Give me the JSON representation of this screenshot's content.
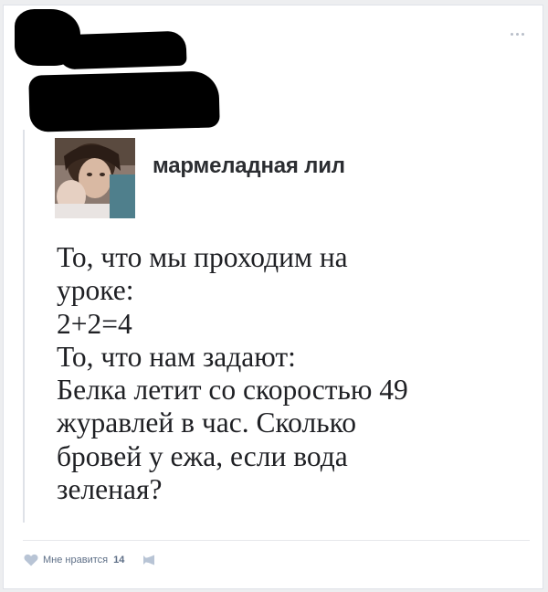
{
  "post": {
    "author_name": "мармеладная лил",
    "text_lines": [
      "То, что мы проходим на",
      "уроке:",
      "2+2=4",
      "То, что нам задают:",
      "Белка летит со скоростью 49",
      "журавлей в час. Сколько",
      "бровей у ежа, если вода",
      "зеленая?"
    ]
  },
  "footer": {
    "like_label": "Мне нравится",
    "like_count": "14"
  },
  "icons": {
    "more": "more-dots-icon",
    "like": "heart-icon",
    "share": "share-icon"
  },
  "colors": {
    "page_bg": "#edeef0",
    "card_bg": "#ffffff",
    "footer_text": "#5e6f87",
    "icon": "#b8c4d5"
  }
}
